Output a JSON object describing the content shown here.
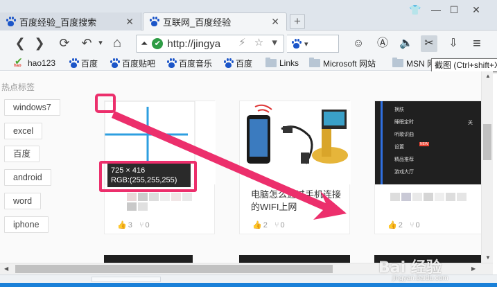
{
  "window": {
    "controls": {
      "shirt": "👕",
      "minimize": "—",
      "maximize": "☐",
      "close": "✕"
    }
  },
  "tabs": [
    {
      "label": "百度经验_百度搜索",
      "close": "✕"
    },
    {
      "label": "互联网_百度经验",
      "close": "✕"
    }
  ],
  "new_tab_label": "+",
  "nav": {
    "back": "❮",
    "forward": "❯",
    "reload": "⟳",
    "undo": "↶",
    "undo_arrow": "▾",
    "home": "⌂"
  },
  "address": {
    "url": "http://jingya",
    "flash": "⚡",
    "star": "☆",
    "dropdown": "▾"
  },
  "toolbar_right": {
    "chat": "☺",
    "ad": "Ⓐ",
    "sound": "🔈",
    "cut": "✂",
    "download": "⇩",
    "menu": "≡"
  },
  "tooltip": "截图 (Ctrl+shift+X)",
  "bookmarks": [
    {
      "label": "hao123",
      "icon": "hao-icon"
    },
    {
      "label": "百度",
      "icon": "paw-icon"
    },
    {
      "label": "百度贴吧",
      "icon": "paw-icon"
    },
    {
      "label": "百度音乐",
      "icon": "paw-icon"
    },
    {
      "label": "百度",
      "icon": "paw-icon"
    },
    {
      "label": "Links",
      "icon": "folder-icon"
    },
    {
      "label": "Microsoft 网站",
      "icon": "folder-icon"
    },
    {
      "label": "MSN 网",
      "icon": "folder-icon"
    }
  ],
  "sidebar": {
    "section_label": "热点标签",
    "tags": [
      "windows7",
      "excel",
      "百度",
      "android",
      "word",
      "iphone"
    ]
  },
  "cards": [
    {
      "title": "",
      "likes": "3",
      "shares": "0"
    },
    {
      "title": "电脑怎么通过手机连接的WIFI上网",
      "likes": "2",
      "shares": "0"
    },
    {
      "title": "",
      "likes": "2",
      "shares": "0"
    }
  ],
  "phone_menu": [
    "换肤",
    "睡眠定时",
    "听歌识曲",
    "设置",
    "精品推荐",
    "游戏大厅"
  ],
  "phone_menu_side": "关",
  "phone_menu_badge": "NEW",
  "measure": {
    "size": "725 × 416",
    "rgb": "RGB:(255,255,255)"
  },
  "watermark": {
    "brand": "Bai 经验",
    "sub": "jingyan.baidu.com"
  },
  "colors": {
    "annotation": "#ec2f6c",
    "accent_bar": "#1a80d8",
    "thumb_line": "#2d9fe0"
  }
}
